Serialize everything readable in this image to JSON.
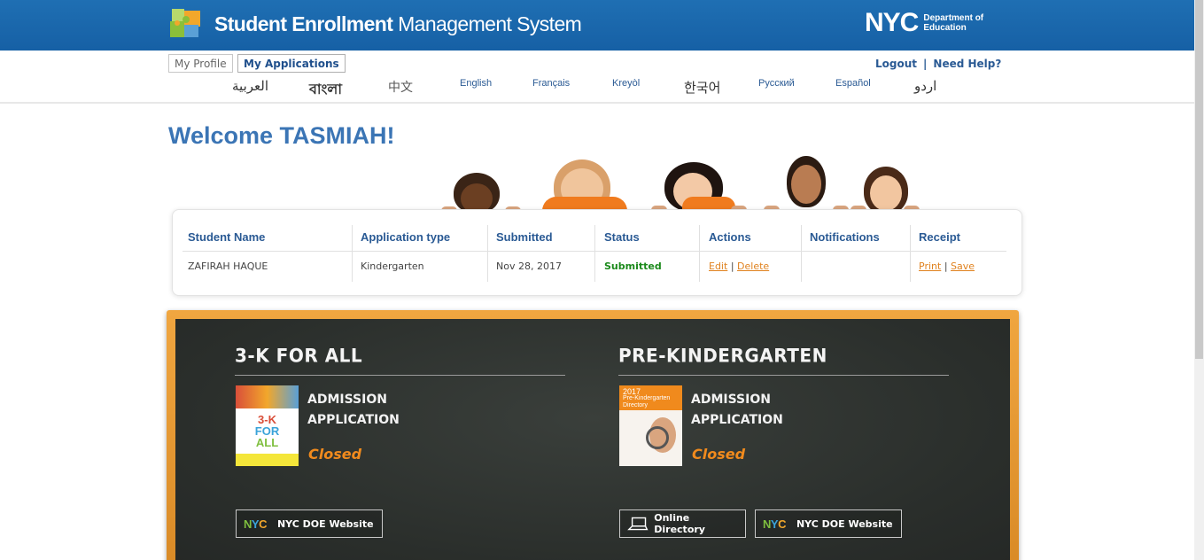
{
  "header": {
    "title_bold": "Student Enrollment",
    "title_rest": " Management System",
    "nyc_logo": "NYC",
    "dept_line1": "Department of",
    "dept_line2": "Education",
    "colors": {
      "bar": "#1f6fb3",
      "accent": "#e0821f",
      "link": "#2a5a94"
    }
  },
  "nav": {
    "my_profile": "My Profile",
    "my_applications": "My Applications",
    "logout": "Logout",
    "separator": "|",
    "need_help": "Need Help?"
  },
  "languages": [
    "العربية",
    "বাংলা",
    "中文",
    "English",
    "Français",
    "Kreyòl",
    "한국어",
    "Русский",
    "Español",
    "اردو"
  ],
  "welcome": "Welcome TASMIAH!",
  "table": {
    "headers": [
      "Student Name",
      "Application type",
      "Submitted",
      "Status",
      "Actions",
      "Notifications",
      "Receipt"
    ],
    "rows": [
      {
        "student_name": "ZAFIRAH HAQUE",
        "application_type": "Kindergarten",
        "submitted": "Nov 28, 2017",
        "status": "Submitted",
        "edit": "Edit",
        "action_sep": "|",
        "delete": "Delete",
        "notifications": "",
        "print": "Print",
        "receipt_sep": "|",
        "save": "Save"
      }
    ]
  },
  "board": {
    "left": {
      "heading": "3-K FOR ALL",
      "line1": "ADMISSION",
      "line2": "APPLICATION",
      "status": "Closed",
      "thumb_text": [
        "3-K",
        "FOR",
        "ALL"
      ],
      "buttons": [
        "NYC DOE Website"
      ]
    },
    "right": {
      "heading": "PRE-KINDERGARTEN",
      "line1": "ADMISSION",
      "line2": "APPLICATION",
      "status": "Closed",
      "thumb_text": [
        "2017",
        "Pre-Kindergarten",
        "Directory"
      ],
      "buttons": [
        "Online Directory",
        "NYC DOE Website"
      ]
    },
    "mini_logo": [
      "N",
      "Y",
      "C"
    ]
  }
}
